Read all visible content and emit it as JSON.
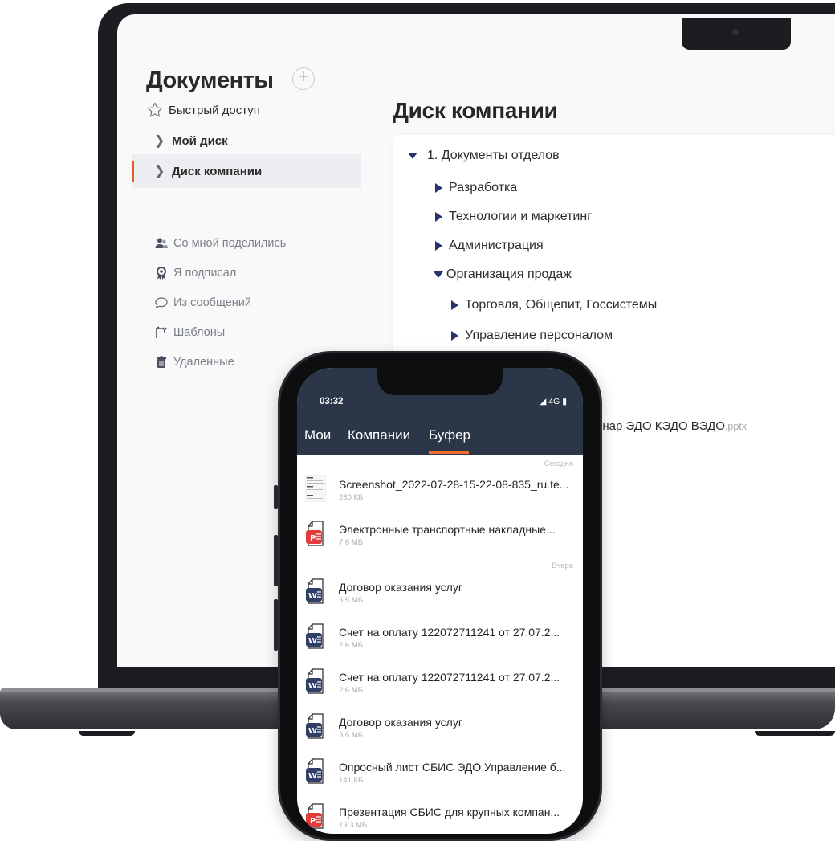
{
  "laptop": {
    "documents_title": "Документы",
    "add_symbol": "+",
    "nav": {
      "quick_access": "Быстрый доступ",
      "my_disk": "Мой диск",
      "company_disk": "Диск компании"
    },
    "sub_nav": [
      {
        "label": "Со мной поделились",
        "icon": "people-icon"
      },
      {
        "label": "Я подписал",
        "icon": "badge-icon"
      },
      {
        "label": "Из сообщений",
        "icon": "chat-icon"
      },
      {
        "label": "Шаблоны",
        "icon": "template-icon"
      },
      {
        "label": "Удаленные",
        "icon": "trash-icon"
      }
    ],
    "main": {
      "title": "Диск компании",
      "tree": [
        {
          "label": "1. Документы отделов",
          "state": "expanded",
          "level": 0
        },
        {
          "label": "Разработка",
          "state": "collapsed",
          "level": 1
        },
        {
          "label": "Технологии и маркетинг",
          "state": "collapsed",
          "level": 1
        },
        {
          "label": "Администрация",
          "state": "collapsed",
          "level": 1
        },
        {
          "label": "Организация продаж",
          "state": "expanded",
          "level": 1
        },
        {
          "label": "Торговля, Общепит, Госсистемы",
          "state": "collapsed",
          "level": 2
        },
        {
          "label": "Управление персоналом",
          "state": "collapsed",
          "level": 2
        }
      ],
      "partial_file": {
        "name": "инар ЭДО КЭДО ВЭДО",
        "ext": ".pptx"
      }
    },
    "accent_color": "#e35a24",
    "tree_arrow_color": "#27336a"
  },
  "phone": {
    "time": "03:32",
    "status": "◢ 4G ▮",
    "tabs": [
      "Мои",
      "Компании",
      "Буфер"
    ],
    "active_tab": "Буфер",
    "header_color": "#2b3649",
    "underline_color": "#f36b2d",
    "sections": {
      "today": "Сегодня",
      "yesterday": "Вчера"
    },
    "files": [
      {
        "name": "Screenshot_2022-07-28-15-22-08-835_ru.te...",
        "size": "280 КБ",
        "type": "screenshot"
      },
      {
        "name": "Электронные транспортные накладные...",
        "size": "7.6 МБ",
        "type": "pdf"
      },
      {
        "name": "Договор оказания услуг",
        "size": "3.5 МБ",
        "type": "word"
      },
      {
        "name": "Счет на оплату 122072711241 от 27.07.2...",
        "size": "2.6 МБ",
        "type": "word"
      },
      {
        "name": "Счет на оплату 122072711241 от 27.07.2...",
        "size": "2.6 МБ",
        "type": "word"
      },
      {
        "name": "Договор оказания услуг",
        "size": "3.5 МБ",
        "type": "word"
      },
      {
        "name": "Опросный лист СБИС ЭДО Управление б...",
        "size": "141 КБ",
        "type": "word"
      },
      {
        "name": "Презентация СБИС для крупных компан...",
        "size": "19.3 МБ",
        "type": "pdf"
      }
    ]
  }
}
